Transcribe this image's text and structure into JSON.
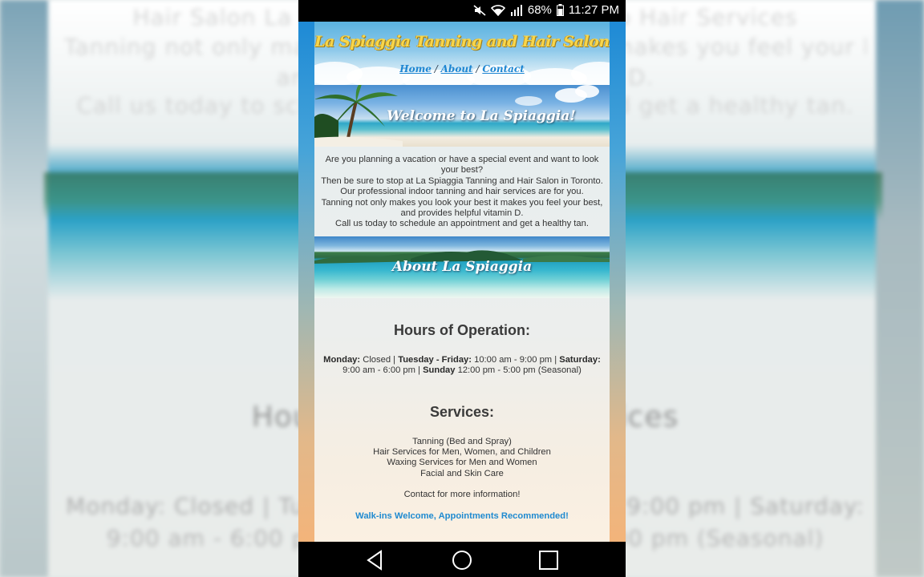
{
  "status_bar": {
    "battery": "68%",
    "time": "11:27 PM",
    "icons": [
      "mute-icon",
      "wifi-icon",
      "signal-icon",
      "battery-icon"
    ]
  },
  "site": {
    "title": "La Spiaggia Tanning and Hair Salon",
    "nav": [
      {
        "label": "Home"
      },
      {
        "label": "About"
      },
      {
        "label": "Contact"
      }
    ],
    "nav_separator": "/"
  },
  "welcome_banner": {
    "text": "Welcome to La Spiaggia!"
  },
  "intro": {
    "lines": [
      "Are you planning a vacation or have a special event and want to look your best?",
      "Then be sure to stop at La Spiaggia Tanning and Hair Salon in Toronto.",
      "Our professional indoor tanning and hair services are for you.",
      "Tanning not only makes you look your best it makes you feel your best, and provides helpful vitamin D.",
      "Call us today to schedule an appointment and get a healthy tan."
    ]
  },
  "about_banner": {
    "text": "About La Spiaggia"
  },
  "hours": {
    "heading": "Hours of Operation:",
    "monday_label": "Monday:",
    "monday_value": " Closed | ",
    "tuefri_label": "Tuesday - Friday:",
    "tuefri_value": " 10:00 am - 9:00 pm | ",
    "saturday_label": "Saturday:",
    "saturday_value": " 9:00 am - 6:00 pm | ",
    "sunday_label": "Sunday",
    "sunday_value": " 12:00 pm - 5:00 pm (Seasonal)"
  },
  "services": {
    "heading": "Services:",
    "items": [
      "Tanning (Bed and Spray)",
      "Hair Services for Men, Women, and Children",
      "Waxing Services for Men and Women",
      "Facial and Skin Care"
    ],
    "contact_text": "Contact for more information!",
    "walkins_text": "Walk-ins Welcome, Appointments Recommended!"
  },
  "nav_bar": {
    "buttons": [
      "back-icon",
      "home-icon",
      "recents-icon"
    ]
  },
  "colors": {
    "title_yellow": "#f8d64a",
    "link_blue": "#1e86d2",
    "walkins_blue": "#1f8ad0"
  }
}
